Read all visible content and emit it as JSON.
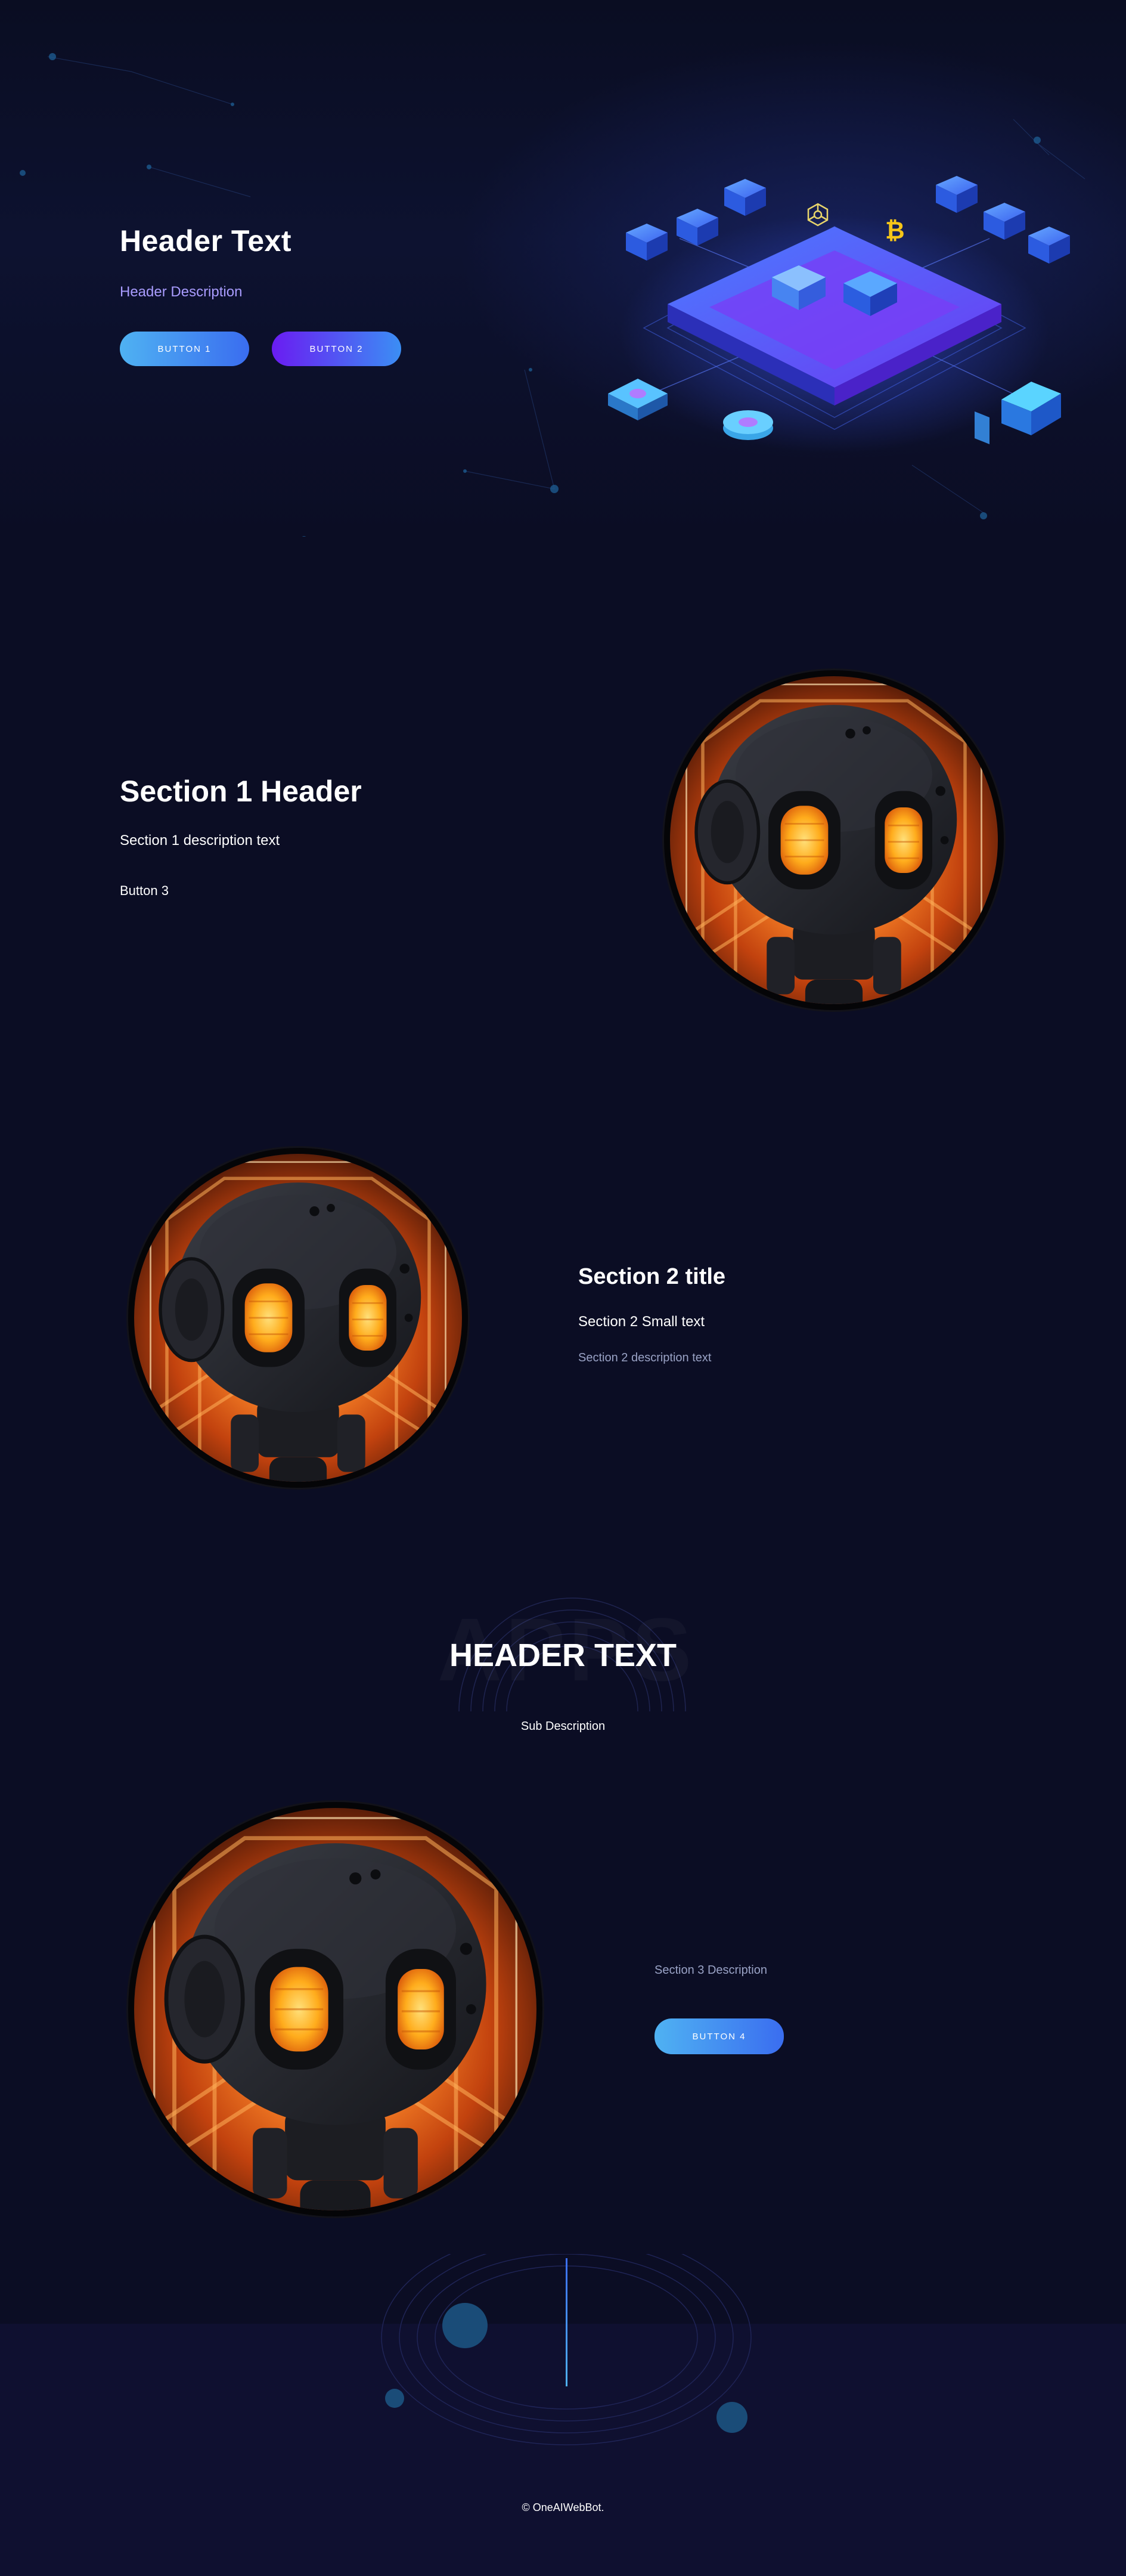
{
  "hero": {
    "title": "Header Text",
    "description": "Header Description",
    "button1_label": "BUTTON 1",
    "button2_label": "BUTTON 2",
    "illustration_icons": [
      "bitcoin-icon",
      "network-hexagon-icon"
    ],
    "bitcoin_symbol": "₿"
  },
  "section1": {
    "title": "Section 1 Header",
    "description": "Section 1 description text",
    "button_label": "Button 3"
  },
  "section2": {
    "title": "Section 2 title",
    "small_text": "Section 2 Small text",
    "description": "Section 2 description text"
  },
  "apps": {
    "watermark": "APPS",
    "title": "HEADER TEXT",
    "subtitle": "Sub Description"
  },
  "section3": {
    "description": "Section 3 Description",
    "button_label": "BUTTON 4"
  },
  "footer": {
    "copyright": "© OneAIWebBot."
  },
  "colors": {
    "background": "#0b0d24",
    "footer_background": "#0f1030",
    "accent_blue": "#4fb2f2",
    "accent_purple": "#6a1cf2",
    "header_description": "#a99cff",
    "muted_text": "#9aa3c6",
    "robot_glow": "#ff7a1a"
  }
}
